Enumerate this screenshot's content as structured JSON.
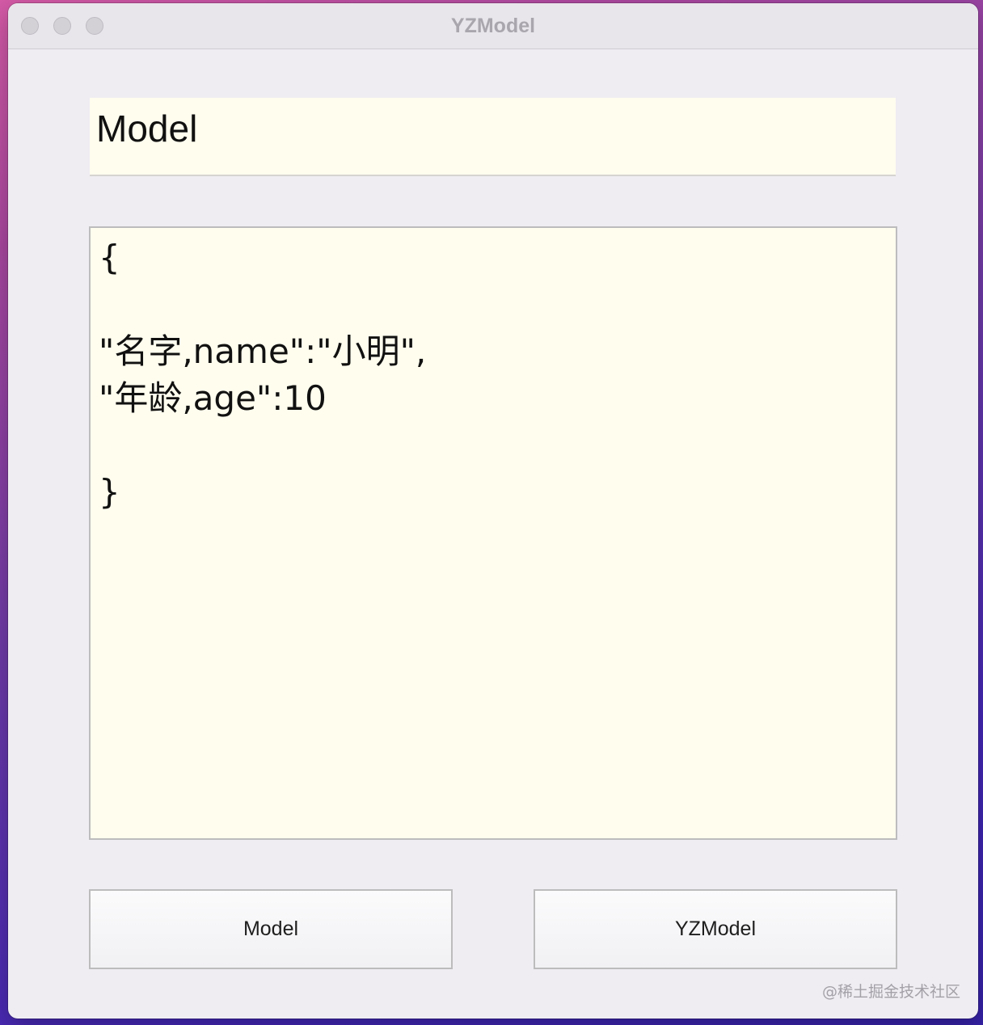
{
  "window": {
    "title": "YZModel"
  },
  "title_field": {
    "value": "Model"
  },
  "json_editor": {
    "lines": [
      "{",
      "",
      "\"名字,name\":\"小明\",",
      "\"年龄,age\":10",
      "",
      "}"
    ]
  },
  "buttons": {
    "model_label": "Model",
    "yzmodel_label": "YZModel"
  },
  "watermark": {
    "text": "@稀土掘金技术社区"
  },
  "colors": {
    "field_background": "#fffdee",
    "window_background": "#efedf2",
    "titlebar_text": "#a9a7ad"
  }
}
